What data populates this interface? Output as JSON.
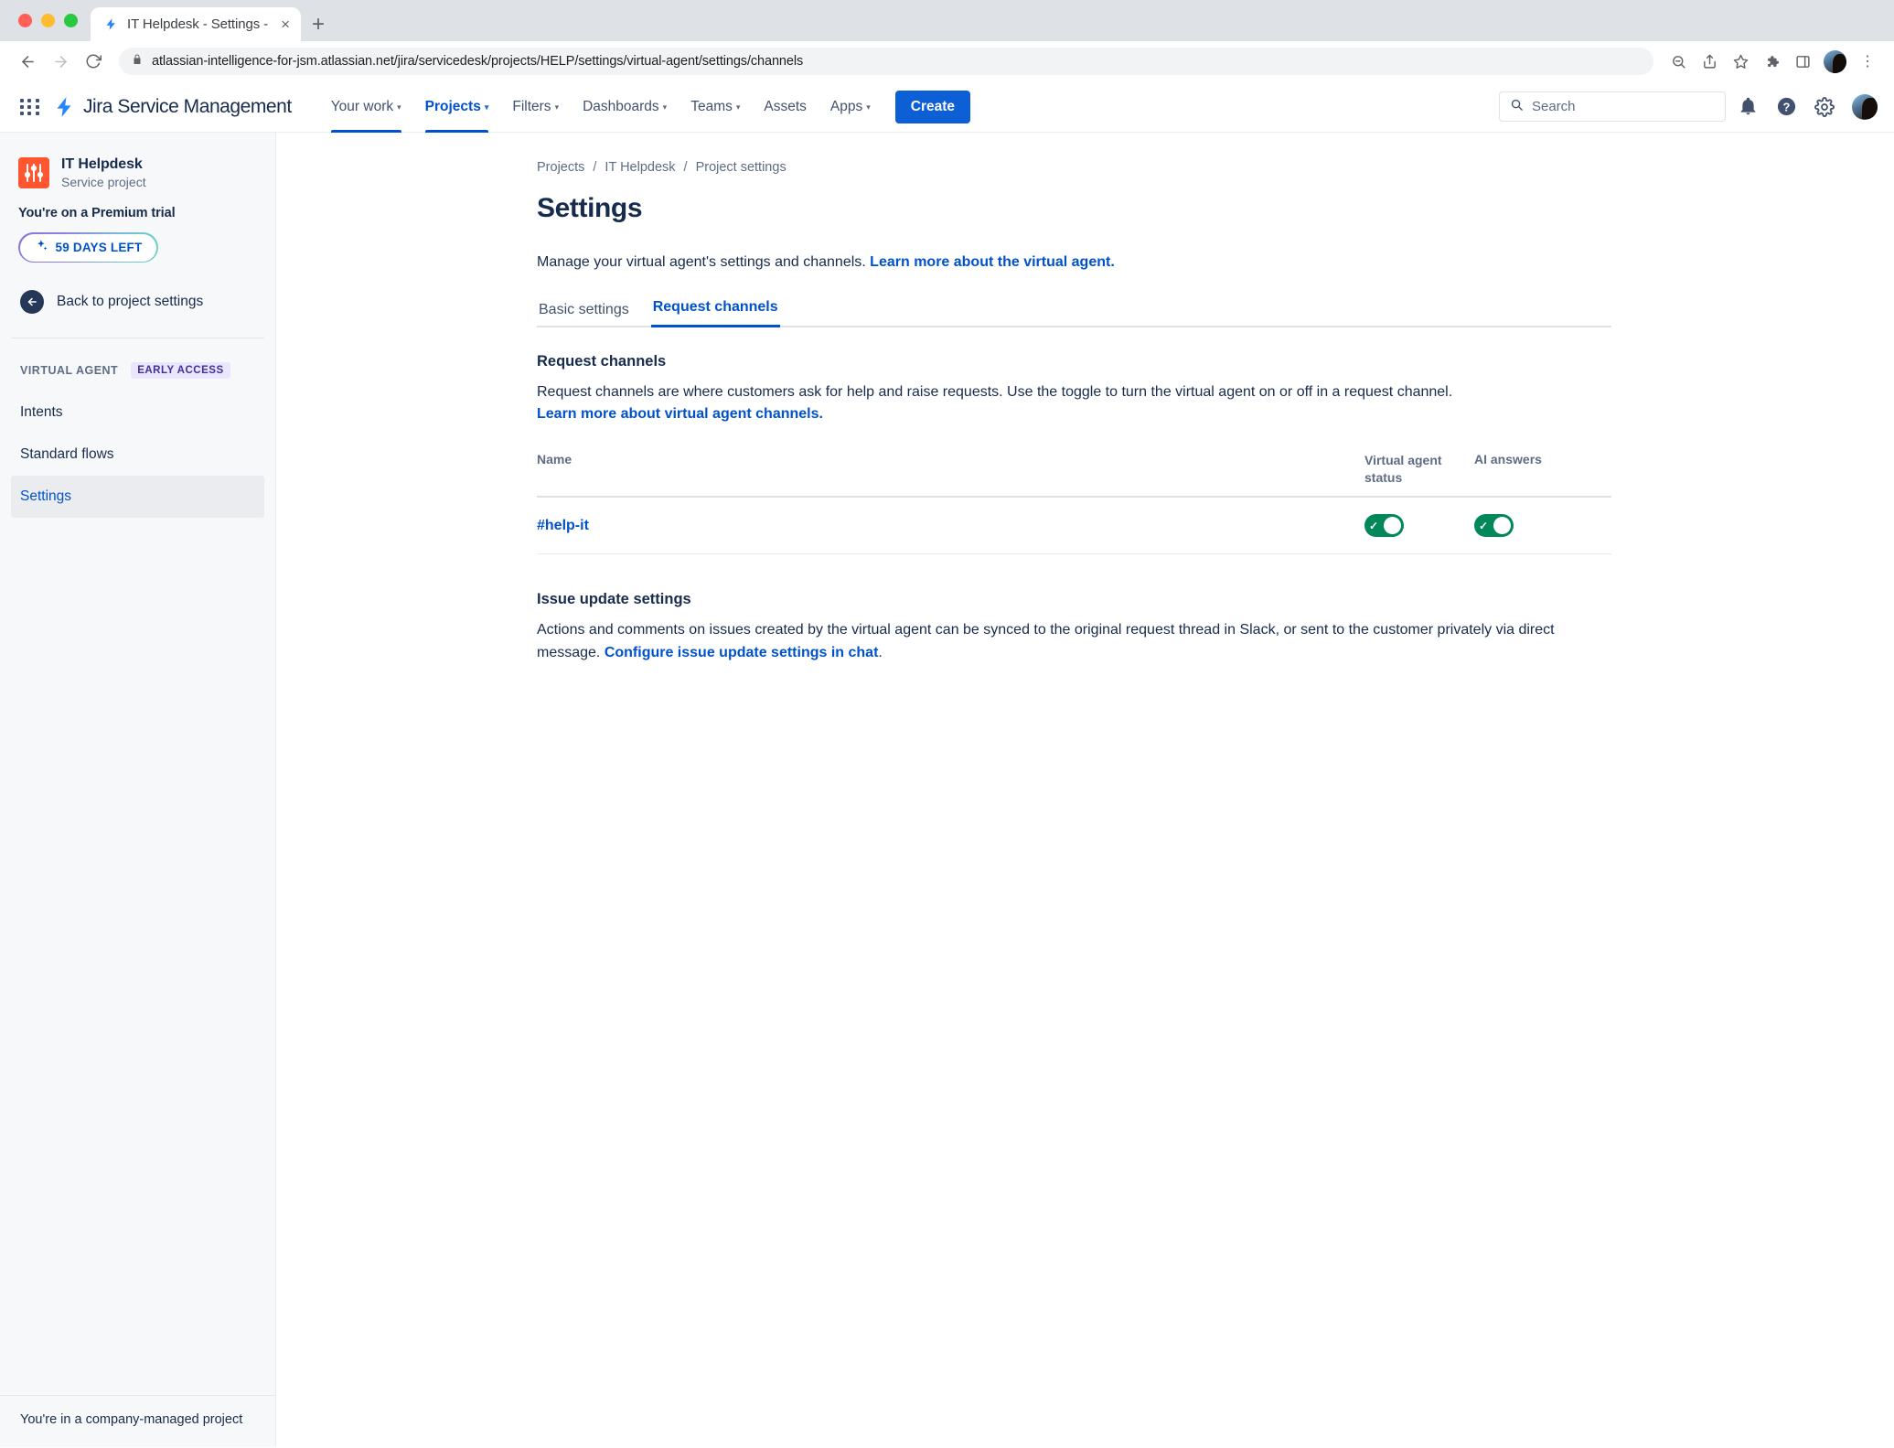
{
  "browser": {
    "tab": {
      "title": "IT Helpdesk - Settings - Servic",
      "favicon": "jira-bolt-icon",
      "close_label": "×"
    },
    "new_tab_label": "+",
    "url": "atlassian-intelligence-for-jsm.atlassian.net/jira/servicedesk/projects/HELP/settings/virtual-agent/settings/channels",
    "lock_icon": "lock-icon",
    "back_icon": "←",
    "forward_icon": "→",
    "reload_icon": "↻",
    "toolbar_icons": [
      "zoom-search-icon",
      "share-icon",
      "bookmark-star-icon",
      "extensions-puzzle-icon",
      "side-panel-icon",
      "profile-avatar",
      "chrome-menu-icon"
    ],
    "menu_label": "⋮"
  },
  "topnav": {
    "app_switcher": "app-switcher-icon",
    "brand": "Jira Service Management",
    "items": [
      {
        "label": "Your work",
        "has_caret": true,
        "active": false
      },
      {
        "label": "Projects",
        "has_caret": true,
        "active": true
      },
      {
        "label": "Filters",
        "has_caret": true,
        "active": false
      },
      {
        "label": "Dashboards",
        "has_caret": true,
        "active": false
      },
      {
        "label": "Teams",
        "has_caret": true,
        "active": false
      },
      {
        "label": "Assets",
        "has_caret": false,
        "active": false
      },
      {
        "label": "Apps",
        "has_caret": true,
        "active": false
      }
    ],
    "create_label": "Create",
    "search_placeholder": "Search",
    "right_icons": [
      "notifications-bell-icon",
      "help-icon",
      "settings-gear-icon",
      "user-avatar"
    ],
    "accent_color": "#0052cc",
    "create_color": "#0c5fd4"
  },
  "sidebar": {
    "project": {
      "name": "IT Helpdesk",
      "type": "Service project",
      "avatar_icon": "project-sliders-icon",
      "avatar_color": "#ff5630"
    },
    "trial": {
      "label": "You're on a Premium trial",
      "pill_text": "59 DAYS LEFT",
      "pill_icon": "premium-sparkle-icon"
    },
    "back": {
      "label": "Back to project settings",
      "icon": "back-arrow-circle-icon"
    },
    "section": {
      "title": "VIRTUAL AGENT",
      "badge": "EARLY ACCESS",
      "badge_color": "#403294",
      "badge_bg": "#eae6ff"
    },
    "items": [
      {
        "label": "Intents",
        "active": false
      },
      {
        "label": "Standard flows",
        "active": false
      },
      {
        "label": "Settings",
        "active": true
      }
    ],
    "footer": "You're in a company-managed project"
  },
  "main": {
    "breadcrumb": [
      {
        "label": "Projects"
      },
      {
        "label": "IT Helpdesk"
      },
      {
        "label": "Project settings"
      }
    ],
    "breadcrumb_separator": "/",
    "page_title": "Settings",
    "description_prefix": "Manage your virtual agent's settings and channels. ",
    "description_link": "Learn more about the virtual agent.",
    "tabs": [
      {
        "label": "Basic settings",
        "active": false
      },
      {
        "label": "Request channels",
        "active": true
      }
    ],
    "request_channels": {
      "title": "Request channels",
      "desc_text": "Request channels are where customers ask for help and raise requests. Use the toggle to turn the virtual agent on or off in a request channel.",
      "desc_link": "Learn more about virtual agent channels.",
      "columns": {
        "name": "Name",
        "virtual_agent_status": "Virtual agent status",
        "ai_answers": "AI answers"
      },
      "rows": [
        {
          "name": "#help-it",
          "virtual_agent_status": true,
          "ai_answers": true
        }
      ],
      "toggle_on_color": "#00875a",
      "toggle_check": "✓"
    },
    "issue_update": {
      "title": "Issue update settings",
      "desc_text_1": "Actions and comments on issues created by the virtual agent can be synced to the original request thread in Slack, or sent to the customer privately via direct message. ",
      "desc_link": "Configure issue update settings in chat",
      "desc_text_2": "."
    }
  }
}
